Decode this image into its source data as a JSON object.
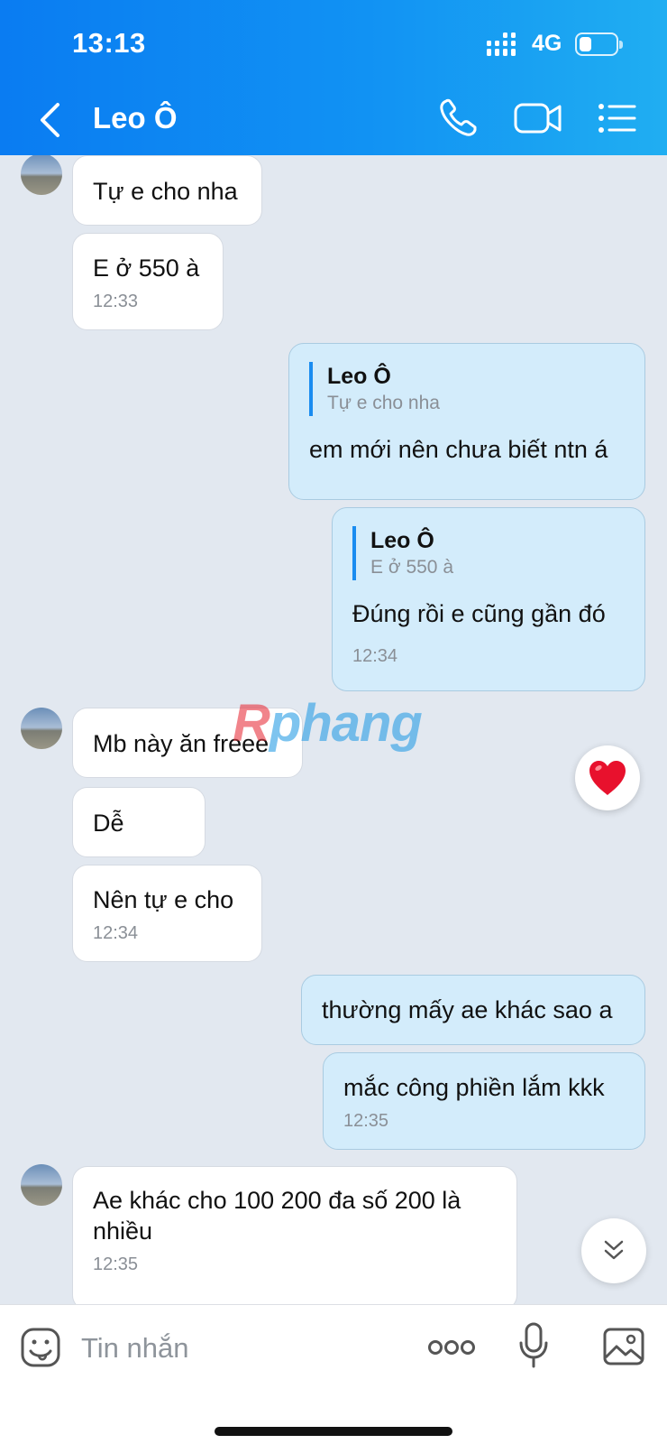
{
  "status_bar": {
    "time": "13:13",
    "network": "4G"
  },
  "header": {
    "contact_name": "Leo Ô"
  },
  "messages": [
    {
      "dir": "in",
      "text": "Tự e cho nha"
    },
    {
      "dir": "in",
      "text": "E ở 550 à",
      "time": "12:33"
    },
    {
      "dir": "out",
      "quote_name": "Leo Ô",
      "quote_text": "Tự e cho nha",
      "text": "em mới nên chưa biết ntn á"
    },
    {
      "dir": "out",
      "quote_name": "Leo Ô",
      "quote_text": "E ở 550 à",
      "text": "Đúng rồi e cũng gần đó",
      "time": "12:34"
    },
    {
      "dir": "in",
      "text": "Mb này ăn freee"
    },
    {
      "dir": "in",
      "text": "Dễ"
    },
    {
      "dir": "in",
      "text": "Nên tự e cho",
      "time": "12:34"
    },
    {
      "dir": "out",
      "text": "thường mấy ae khác sao a"
    },
    {
      "dir": "out",
      "text": "mắc công phiền lắm kkk",
      "time": "12:35"
    },
    {
      "dir": "in",
      "text": "Ae khác cho 100 200 đa số 200 là nhiều",
      "time": "12:35"
    }
  ],
  "watermark": {
    "first": "R",
    "rest": "phang"
  },
  "input": {
    "placeholder": "Tin nhắn"
  },
  "colors": {
    "header_start": "#0a7cf2",
    "header_end": "#20aef2",
    "outgoing_bubble": "#d3ecfb",
    "chat_background": "#e2e8f0",
    "accent": "#1a8cf0"
  },
  "icons": {
    "call": "phone-icon",
    "video": "video-camera-icon",
    "menu": "list-menu-icon",
    "reaction": "heart-icon"
  }
}
